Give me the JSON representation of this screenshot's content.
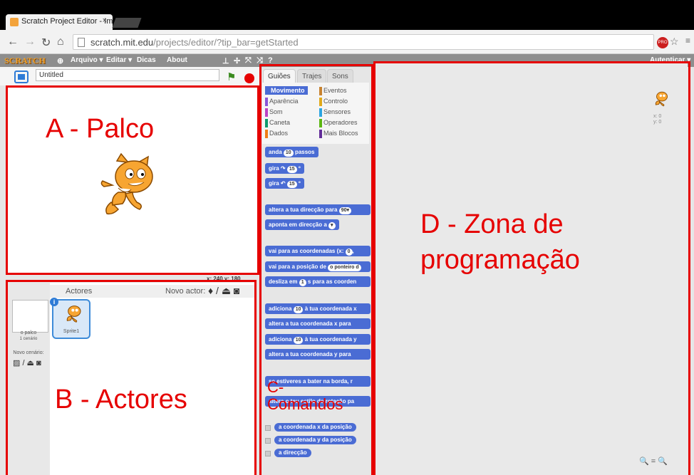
{
  "browser": {
    "tab_title": "Scratch Project Editor - Im",
    "tab_close": "×",
    "url_host": "scratch.mit.edu",
    "url_path": "/projects/editor/?tip_bar=getStarted",
    "pro_badge": "PRO"
  },
  "menubar": {
    "logo": "SCRATCH",
    "items": [
      "Arquivo ▾",
      "Editar ▾",
      "Dicas",
      "About"
    ],
    "signin": "Autenticar ▾"
  },
  "project": {
    "title_value": "Untitled"
  },
  "stage": {
    "coords": "x: 240  y: 180"
  },
  "sprites": {
    "header_label": "Actores",
    "new_sprite_label": "Novo actor:",
    "stage_name": "o palco",
    "stage_backdrops": "1 cenário",
    "new_backdrop_label": "Novo cenário:",
    "sprite_name": "Sprite1",
    "info_badge": "i"
  },
  "palette": {
    "tabs": [
      "Guiões",
      "Trajes",
      "Sons"
    ],
    "categories": [
      {
        "label": "Movimento",
        "color": "#4a6cd4"
      },
      {
        "label": "Eventos",
        "color": "#c88330"
      },
      {
        "label": "Aparência",
        "color": "#8a55d7"
      },
      {
        "label": "Controlo",
        "color": "#e1a91a"
      },
      {
        "label": "Som",
        "color": "#bb42c3"
      },
      {
        "label": "Sensores",
        "color": "#2ca5e2"
      },
      {
        "label": "Caneta",
        "color": "#0e9a6c"
      },
      {
        "label": "Operadores",
        "color": "#5cb712"
      },
      {
        "label": "Dados",
        "color": "#ee7d16"
      },
      {
        "label": "Mais Blocos",
        "color": "#632d99"
      }
    ],
    "blocks": [
      {
        "pre": "anda",
        "num": "10",
        "post": "passos"
      },
      {
        "pre": "gira ↷",
        "num": "15",
        "post": "º"
      },
      {
        "pre": "gira ↶",
        "num": "15",
        "post": "º"
      },
      {
        "pre": "altera a tua direcção para",
        "num": "90▾",
        "post": ""
      },
      {
        "pre": "aponta em direcção a",
        "num": "",
        "post": "▾"
      },
      {
        "pre": "vai para as coordenadas (x:",
        "num": "0",
        "post": ","
      },
      {
        "pre": "vai para a posição de",
        "num": "o ponteiro d",
        "post": ""
      },
      {
        "pre": "desliza em",
        "num": "1",
        "post": "s para as coorden"
      },
      {
        "pre": "adiciona",
        "num": "10",
        "post": "à tua coordenada x"
      },
      {
        "pre": "altera a tua coordenada x para",
        "num": "",
        "post": ""
      },
      {
        "pre": "adiciona",
        "num": "10",
        "post": "à tua coordenada y"
      },
      {
        "pre": "altera a tua coordenada y para",
        "num": "",
        "post": ""
      },
      {
        "pre": "se estiveres a bater na borda, r",
        "num": "",
        "post": ""
      },
      {
        "pre": "altera o teu estilo de rotação pa",
        "num": "",
        "post": ""
      }
    ],
    "reporters": [
      "a coordenada x da posição",
      "a coordenada y da posição",
      "a direcção"
    ]
  },
  "script_area": {
    "coords": "x: 0\ny: 0",
    "zoom": "🔍 = 🔍"
  },
  "annotations": {
    "a": "A - Palco",
    "b": "B - Actores",
    "c": "C-\nComandos",
    "d": "D - Zona de\nprogramação",
    "color": "#e60000"
  }
}
